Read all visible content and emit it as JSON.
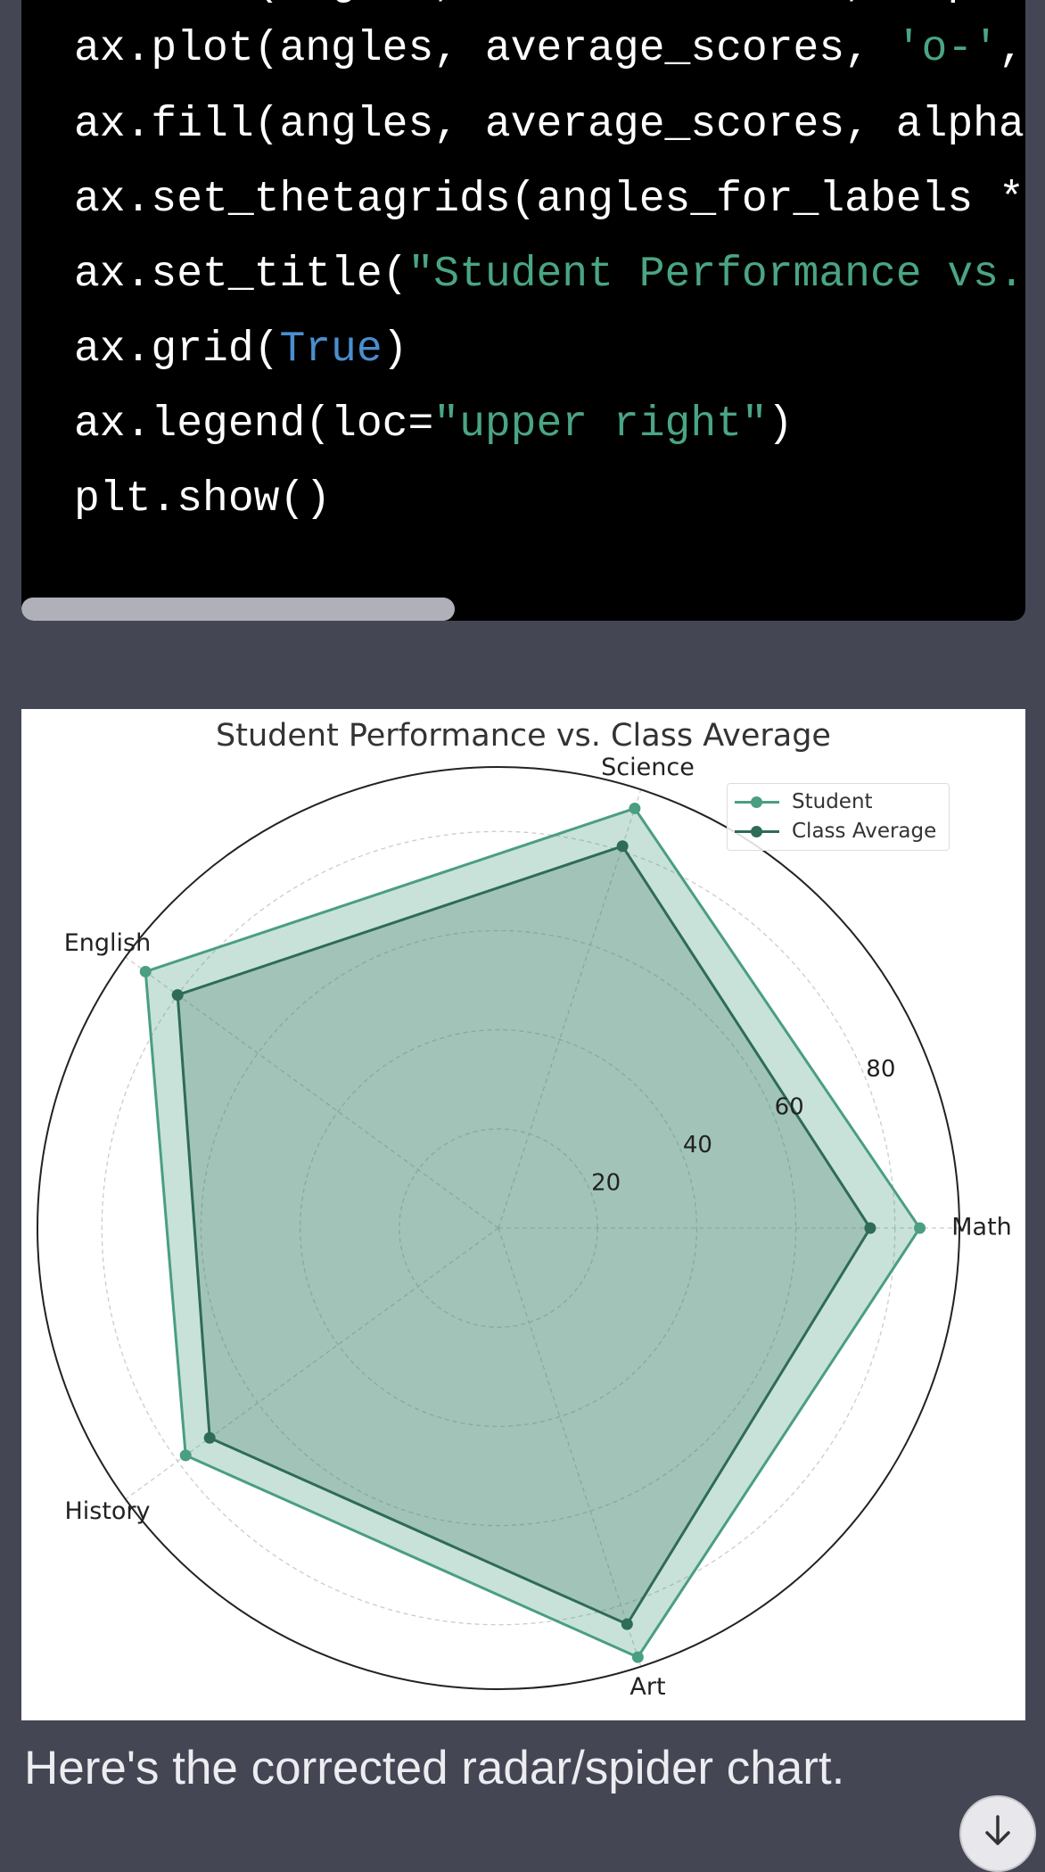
{
  "code": {
    "lines": [
      [
        {
          "t": "ax.fill(angles, student_scores, alpha",
          "c": ""
        }
      ],
      [
        {
          "t": "ax.plot(angles, average_scores, ",
          "c": ""
        },
        {
          "t": "'o-'",
          "c": "str"
        },
        {
          "t": ", ",
          "c": ""
        }
      ],
      [
        {
          "t": "ax.fill(angles, average_scores, alpha",
          "c": ""
        }
      ],
      [
        {
          "t": "ax.set_thetagrids(angles_for_labels *",
          "c": ""
        }
      ],
      [
        {
          "t": "ax.set_title(",
          "c": ""
        },
        {
          "t": "\"Student Performance vs.",
          "c": "str"
        }
      ],
      [
        {
          "t": "ax.grid(",
          "c": ""
        },
        {
          "t": "True",
          "c": "kw"
        },
        {
          "t": ")",
          "c": ""
        }
      ],
      [
        {
          "t": "ax.legend(loc=",
          "c": ""
        },
        {
          "t": "\"upper right\"",
          "c": "str"
        },
        {
          "t": ")",
          "c": ""
        }
      ],
      [
        {
          "t": "plt.show()",
          "c": ""
        }
      ]
    ]
  },
  "chart_data": {
    "type": "radar",
    "title": "Student Performance vs. Class Average",
    "categories": [
      "Math",
      "Science",
      "English",
      "History",
      "Art"
    ],
    "series": [
      {
        "name": "Student",
        "values": [
          85,
          89,
          88,
          78,
          91
        ],
        "color": "#4a9e82"
      },
      {
        "name": "Class Average",
        "values": [
          75,
          81,
          80,
          72,
          84
        ],
        "color": "#2e6b58"
      }
    ],
    "radial_ticks": [
      20,
      40,
      60,
      80
    ],
    "rlim": [
      0,
      93
    ],
    "grid": true,
    "legend_position": "upper right"
  },
  "message": "Here's the corrected radar/spider chart.",
  "icons": {
    "scroll_down": "arrow-down-icon"
  }
}
